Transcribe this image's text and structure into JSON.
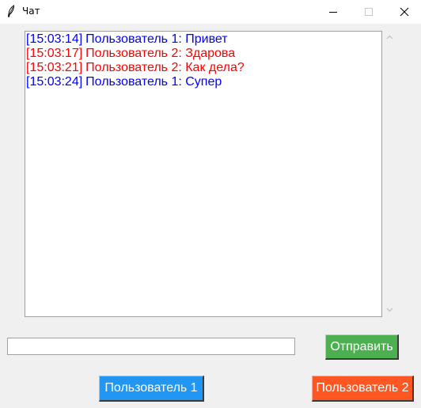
{
  "window": {
    "title": "Чат",
    "icon": "feather-icon",
    "controls": [
      "minimize-icon",
      "maximize-icon",
      "close-icon"
    ]
  },
  "chat": {
    "messages": [
      {
        "time": "[15:03:14]",
        "text": "Пользователь 1: Привет",
        "color": "#0000ff"
      },
      {
        "time": "[15:03:17]",
        "text": "Пользователь 2: Здарова",
        "color": "#ff0000"
      },
      {
        "time": "[15:03:21]",
        "text": "Пользователь 2: Как дела?",
        "color": "#ff0000"
      },
      {
        "time": "[15:03:24]",
        "text": "Пользователь 1: Супер",
        "color": "#0000ff"
      }
    ]
  },
  "input": {
    "value": "",
    "placeholder": ""
  },
  "buttons": {
    "send": {
      "label": "Отправить",
      "color": "#4caf50"
    },
    "user1": {
      "label": "Пользователь 1",
      "color": "#2196f3"
    },
    "user2": {
      "label": "Пользователь 2",
      "color": "#ff5722"
    }
  }
}
